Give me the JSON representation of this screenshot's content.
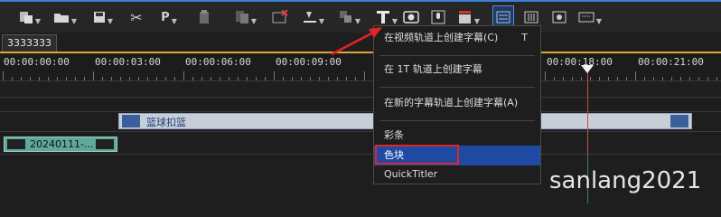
{
  "toolbar": {
    "icons": [
      "new-sequence-icon",
      "open-folder-icon",
      "save-icon",
      "cut-icon",
      "paste-icon",
      "clipboard-icon",
      "copy-icon",
      "delete-icon",
      "marker-icon",
      "transform-icon",
      "title-icon",
      "camera-icon",
      "microphone-icon",
      "clapper-icon",
      "timeline-view-icon",
      "audio-mixer-icon",
      "fx-icon",
      "keyboard-icon"
    ],
    "paste_glyph": "P"
  },
  "sequence_tab": "3333333",
  "ruler": {
    "timecodes": [
      "00:00:00:00",
      "00:00:03:00",
      "00:00:06:00",
      "00:00:09:00",
      "00:00:18:00",
      "00:00:21:00"
    ]
  },
  "clips": {
    "title_clip": "篮球扣篮",
    "video_clip": "20240111-..."
  },
  "menu": {
    "create_on_video_track": "在视频轨道上创建字幕(C)",
    "create_on_video_track_shortcut": "T",
    "create_on_1t_track": "在 1T 轨道上创建字幕",
    "create_on_new_track": "在新的字幕轨道上创建字幕(A)",
    "color_bars": "彩条",
    "color_block": "色块",
    "quick_titler": "QuickTitler"
  },
  "watermark": "sanlang2021",
  "colors": {
    "menu_highlight": "#1f4aa3",
    "annotation_red": "#e02525",
    "ruler_accent": "#e0a43a",
    "playhead": "#c94a4a"
  }
}
